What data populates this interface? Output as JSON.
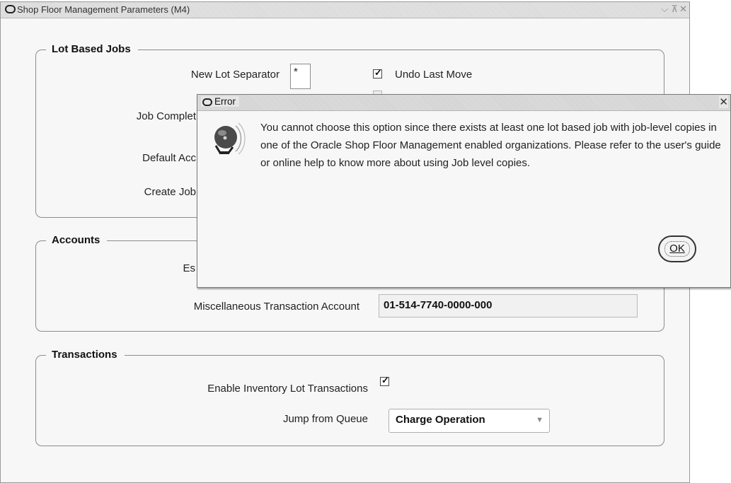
{
  "window": {
    "title": "Shop Floor Management Parameters (M4)",
    "controls": "⌫ ⊼ ✕"
  },
  "lot_jobs": {
    "heading": "Lot Based Jobs",
    "new_lot_separator_label": "New Lot Separator",
    "new_lot_separator_value": "*",
    "undo_last_move_label": "Undo Last Move",
    "undo_last_move_checked": true,
    "job_completion_label": "Job Complet",
    "default_account_label": "Default Acc",
    "create_job_label": "Create Job"
  },
  "accounts": {
    "heading": "Accounts",
    "estimated_label": "Es",
    "misc_account_label": "Miscellaneous Transaction Account",
    "misc_account_value": "01-514-7740-0000-000"
  },
  "transactions": {
    "heading": "Transactions",
    "enable_lot_label": "Enable Inventory Lot Transactions",
    "enable_lot_checked": true,
    "jump_queue_label": "Jump from Queue",
    "jump_queue_value": "Charge Operation"
  },
  "dialog": {
    "title": "Error",
    "close": "✕",
    "message": "You cannot choose this option since there exists at least one lot based job with job-level copies in one of the Oracle Shop Floor Management enabled organizations. Please refer to the user's guide or online help to know more about using Job level copies.",
    "ok_label": "OK",
    "icon": "bell-icon"
  }
}
